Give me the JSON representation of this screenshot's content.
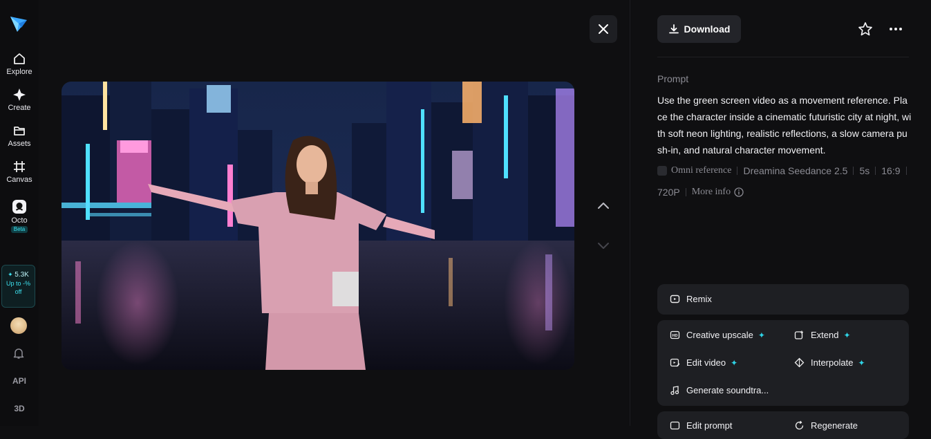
{
  "sidebar": {
    "nav": [
      {
        "label": "Explore",
        "icon": "home-icon"
      },
      {
        "label": "Create",
        "icon": "sparkle-icon"
      },
      {
        "label": "Assets",
        "icon": "folder-icon"
      },
      {
        "label": "Canvas",
        "icon": "canvas-icon"
      },
      {
        "label": "Octo",
        "icon": "octo-icon",
        "badge": "Beta"
      }
    ],
    "promo": {
      "credits": "5.3K",
      "line1": "Up to -%",
      "line2": "off"
    },
    "api_label": "API",
    "three_d_label": "3D"
  },
  "toolbar": {
    "download_label": "Download"
  },
  "prompt": {
    "label": "Prompt",
    "text": "Use the green screen video as a movement reference. Place the character inside a cinematic futuristic city at night, with soft neon lighting, realistic reflections, a slow camera push-in, and natural character movement."
  },
  "meta": {
    "reference": "Omni reference",
    "model": "Dreamina Seedance 2.5",
    "duration": "5s",
    "ratio": "16:9",
    "resolution": "720P",
    "more_info": "More info"
  },
  "actions": {
    "remix": "Remix",
    "creative_upscale": "Creative upscale",
    "extend": "Extend",
    "edit_video": "Edit video",
    "interpolate": "Interpolate",
    "generate_soundtrack": "Generate soundtra...",
    "edit_prompt": "Edit prompt",
    "regenerate": "Regenerate"
  },
  "colors": {
    "background": "#0f0f11",
    "accent": "#2fd3e6",
    "card": "#1e1f23"
  }
}
